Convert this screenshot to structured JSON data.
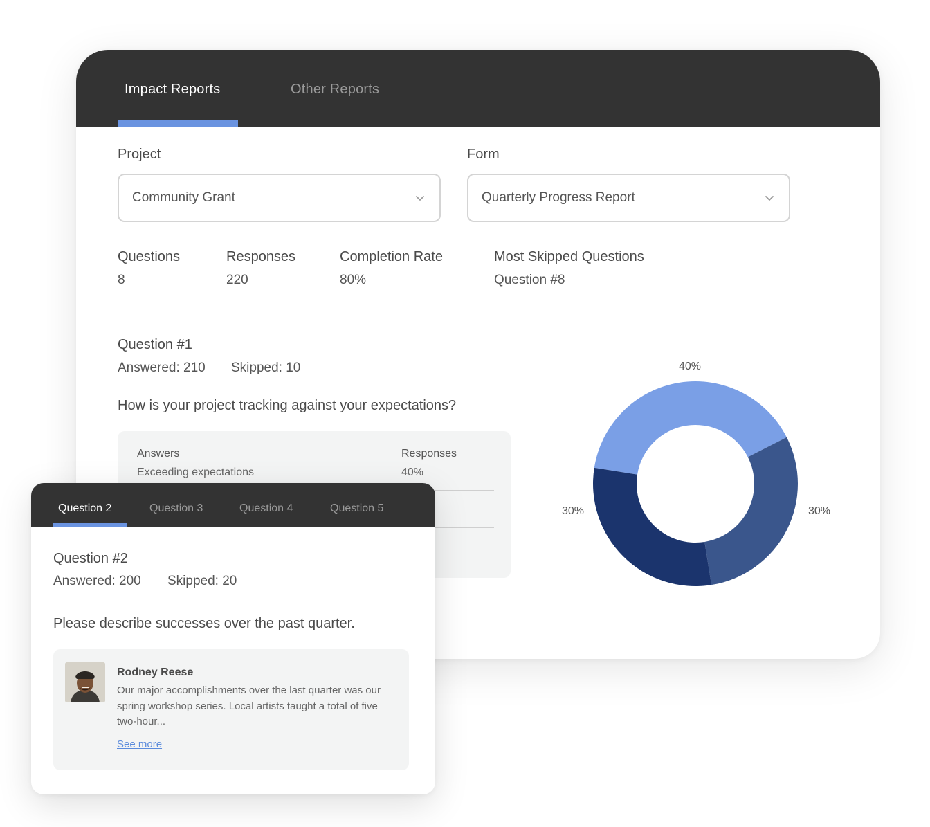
{
  "main": {
    "tabs": {
      "active": "Impact Reports",
      "other": "Other Reports"
    },
    "project": {
      "label": "Project",
      "value": "Community Grant"
    },
    "form": {
      "label": "Form",
      "value": "Quarterly Progress Report"
    },
    "stats": {
      "questions": {
        "label": "Questions",
        "value": "8"
      },
      "responses": {
        "label": "Responses",
        "value": "220"
      },
      "completion": {
        "label": "Completion Rate",
        "value": "80%"
      },
      "skipped": {
        "label": "Most Skipped Questions",
        "value": "Question #8"
      }
    },
    "question": {
      "title": "Question #1",
      "answered": "Answered: 210",
      "skipped": "Skipped: 10",
      "text": "How is your project tracking against your expectations?"
    },
    "answers_table": {
      "header_answers": "Answers",
      "header_responses": "Responses",
      "rows": [
        {
          "answer": "Exceeding expectations",
          "responses": "40%"
        }
      ]
    }
  },
  "chart_data": {
    "type": "pie",
    "donut": true,
    "values": [
      40,
      30,
      30
    ],
    "labels": [
      "40%",
      "30%",
      "30%"
    ],
    "colors": [
      "#7a9fe6",
      "#3a568c",
      "#1b346d"
    ]
  },
  "overlay": {
    "tabs": [
      "Question 2",
      "Question 3",
      "Question 4",
      "Question 5"
    ],
    "active_tab": 0,
    "title": "Question #2",
    "answered": "Answered: 200",
    "skipped": "Skipped: 20",
    "question": "Please describe successes over the past quarter.",
    "response": {
      "name": "Rodney Reese",
      "text": "Our major accomplishments over the last quarter was our spring workshop series. Local artists taught a total of five two-hour...",
      "see_more": "See more"
    }
  },
  "colors": {
    "header": "#333333",
    "accent": "#6a93e0",
    "panel": "#f3f4f4",
    "link": "#5b8bdc"
  }
}
